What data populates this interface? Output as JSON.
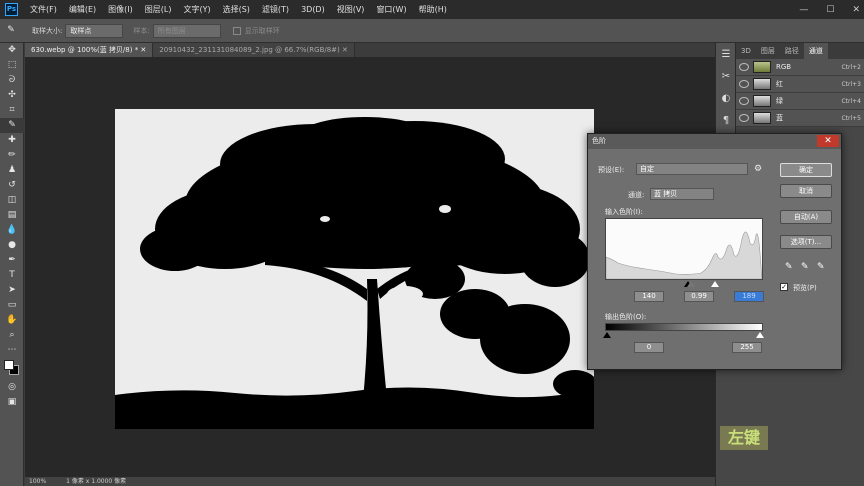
{
  "menubar": {
    "logo": "Ps",
    "items": [
      "文件(F)",
      "编辑(E)",
      "图像(I)",
      "图层(L)",
      "文字(Y)",
      "选择(S)",
      "滤镜(T)",
      "3D(D)",
      "视图(V)",
      "窗口(W)",
      "帮助(H)"
    ],
    "minimize": "—",
    "maximize": "☐",
    "close": "✕"
  },
  "options": {
    "sample_size_label": "取样大小:",
    "sample_size_value": "取样点",
    "sample_label": "样本:",
    "sample_value": "所有图层",
    "show_ring_label": "显示取样环"
  },
  "tabs": [
    {
      "label": "630.webp @ 100%(蓝 拷贝/8) *  ✕"
    },
    {
      "label": "20910432_231131084089_2.jpg @ 66.7%(RGB/8#)  ✕"
    }
  ],
  "status": {
    "zoom": "100%",
    "info": "1 像素 x 1.0000 像素"
  },
  "panel": {
    "tabs": [
      "3D",
      "图层",
      "路径",
      "通道"
    ],
    "active_tab": "通道",
    "channels": [
      {
        "name": "RGB",
        "key": "Ctrl+2"
      },
      {
        "name": "红",
        "key": "Ctrl+3"
      },
      {
        "name": "绿",
        "key": "Ctrl+4"
      },
      {
        "name": "蓝",
        "key": "Ctrl+5"
      }
    ]
  },
  "hint": "左键",
  "levels": {
    "title": "色阶",
    "close": "✕",
    "preset_label": "预设(E):",
    "preset_value": "自定",
    "channel_label": "通道:",
    "channel_value": "蓝 拷贝",
    "input_label": "输入色阶(I):",
    "input_black": "140",
    "input_gray": "0.99",
    "input_white": "189",
    "output_label": "输出色阶(O):",
    "output_black": "0",
    "output_white": "255",
    "ok": "确定",
    "cancel": "取消",
    "auto": "自动(A)",
    "options": "选项(T)...",
    "preview_label": "预览(P)",
    "preview_checked": true
  }
}
